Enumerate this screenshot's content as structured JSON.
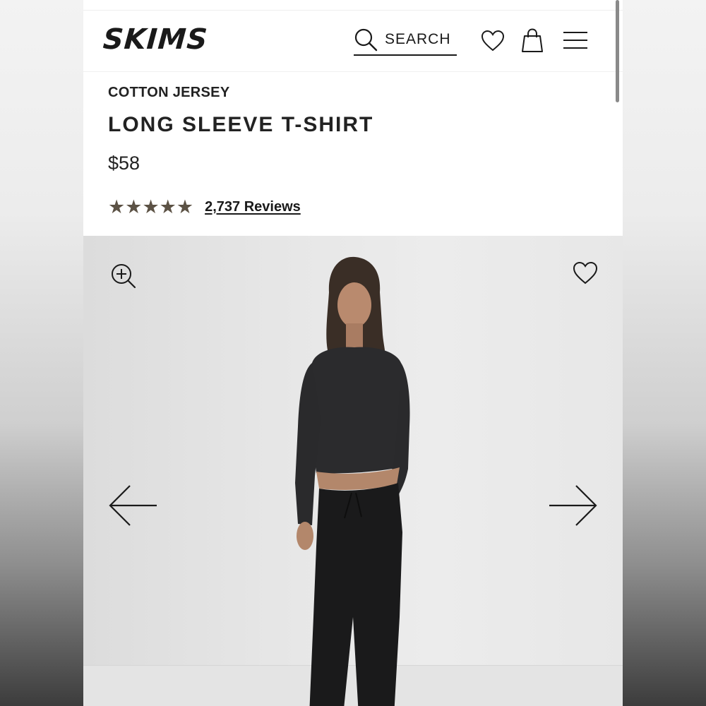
{
  "header": {
    "logo": "SKIMS",
    "search_label": "SEARCH"
  },
  "product": {
    "category": "COTTON JERSEY",
    "title": "LONG SLEEVE T-SHIRT",
    "price": "$58",
    "rating": 4.7,
    "reviews_label": "2,737 Reviews"
  },
  "icons": {
    "search": "search-icon",
    "wishlist": "heart-icon",
    "bag": "shopping-bag-icon",
    "menu": "hamburger-menu-icon",
    "zoom": "zoom-in-icon",
    "favorite": "heart-icon",
    "prev": "arrow-left-icon",
    "next": "arrow-right-icon"
  },
  "colors": {
    "star": "#5c5245",
    "text": "#222222"
  }
}
